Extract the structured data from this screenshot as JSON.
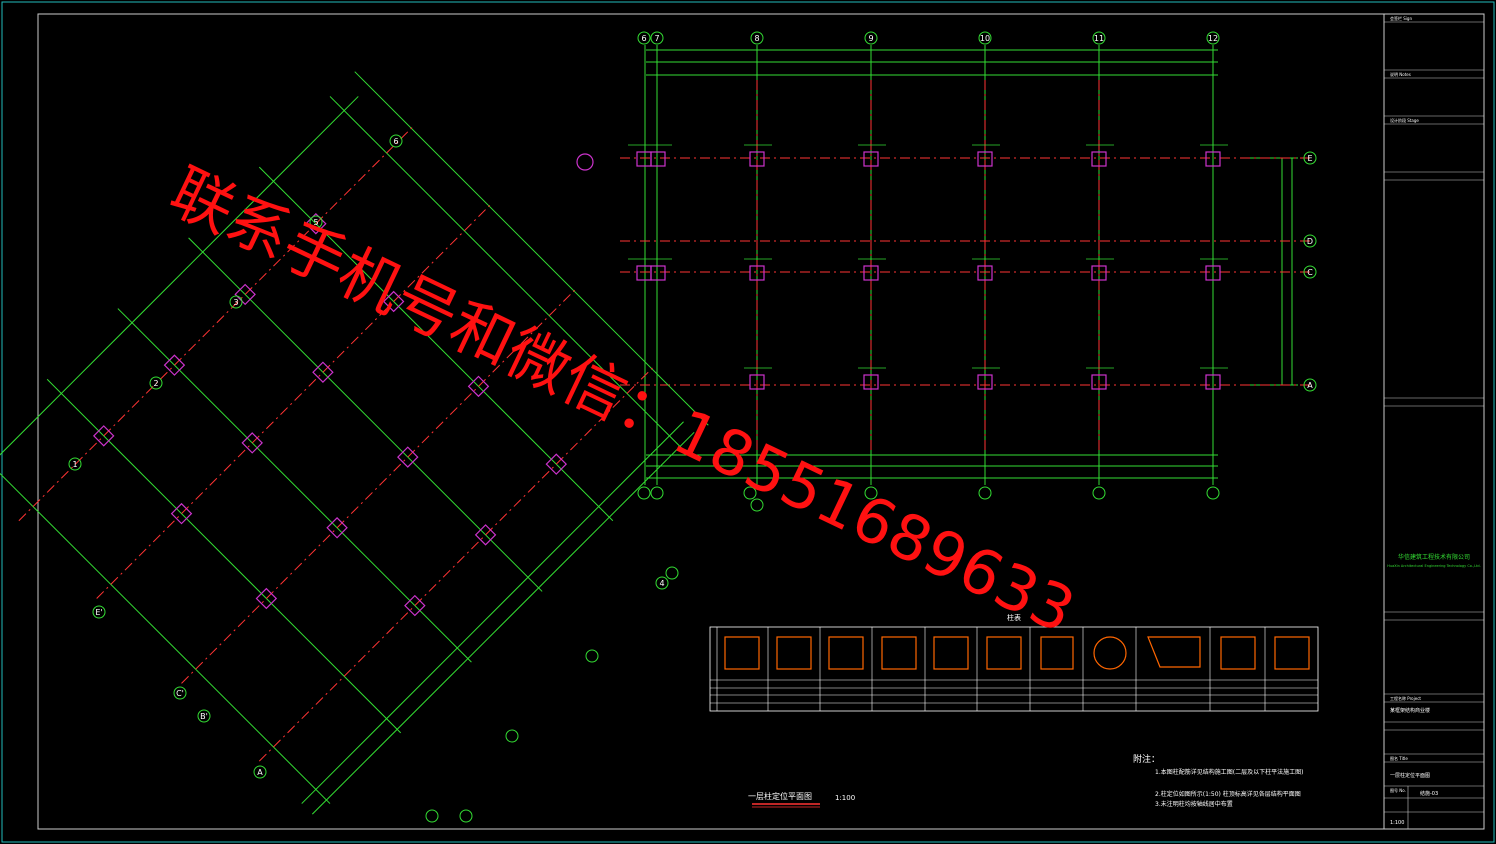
{
  "drawing": {
    "plan_title": "一层柱定位平面图",
    "scale": "1:100",
    "table_title": "柱表",
    "notes_title": "附注：",
    "notes": [
      "1.本图柱配筋详见结构施工图(二层及以下柱平法施工图)",
      "2.柱定位如图所示(1:50) 柱顶标高详见各层结构平面图",
      "3.未注明柱均按轴线居中布置"
    ]
  },
  "grid": {
    "top_axes": [
      "6",
      "7",
      "8",
      "9",
      "10",
      "11",
      "12"
    ],
    "right_axes": [
      "E",
      "D",
      "C",
      "A"
    ],
    "rotated_axes": [
      "1",
      "2",
      "3",
      "4",
      "5",
      "6"
    ],
    "rotated_letter_axes": [
      "A",
      "B'",
      "C'",
      "E'"
    ]
  },
  "title_block": {
    "company": "华信建筑工程技术有限公司",
    "company_en": "HuaXin Architectural Engineering Technology Co.,Ltd.",
    "project": "某框架结构商业楼",
    "drawing_name": "一层柱定位平面图",
    "drawing_no": "结施-03",
    "scale": "1:100",
    "sections": [
      "会签栏 Sign",
      "说明 Notes",
      "设计阶段 Stage",
      "工程名称 Project",
      "图名 Title",
      "图号 No."
    ]
  },
  "watermark": {
    "text": "联系手机号和微信：18551689633"
  },
  "colors": {
    "background": "#000000",
    "grid_green": "#33dd33",
    "axis_red": "#ff3333",
    "column_magenta": "#cc33cc",
    "text_white": "#ffffff",
    "frame_cyan": "#22bbbb",
    "watermark_red": "#ff1111",
    "column_section_orange": "#ff6600"
  }
}
